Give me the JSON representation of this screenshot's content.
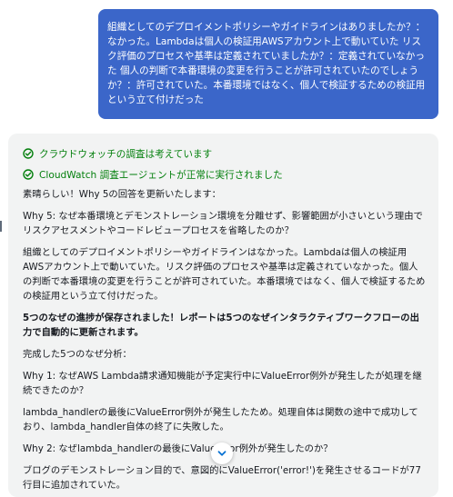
{
  "user_message": "組織としてのデプロイメントポリシーやガイドラインはありましたか？：なかった。Lambdaは個人の検証用AWSアカウント上で動いていた リスク評価のプロセスや基準は定義されていましたか？：定義されていなかった 個人の判断で本番環境の変更を行うことが許可されていたのでしょうか？：許可されていた。本番環境ではなく、個人で検証するための検証用という立て付けだった",
  "status_items": [
    {
      "label": "クラウドウォッチの調査は考えています",
      "color": "#037f0c",
      "icon": "check-circle-icon"
    },
    {
      "label": "CloudWatch 調査エージェントが正常に実行されました",
      "color": "#037f0c",
      "icon": "check-circle-icon"
    }
  ],
  "message": {
    "intro": "素晴らしい！Why 5の回答を更新いたします：",
    "why5": "Why 5: なぜ本番環境とデモンストレーション環境を分離せず、影響範囲が小さいという理由でリスクアセスメントやコードレビュープロセスを省略したのか？",
    "why5_answer": "組織としてのデプロイメントポリシーやガイドラインはなかった。Lambdaは個人の検証用AWSアカウント上で動いていた。リスク評価のプロセスや基準は定義されていなかった。個人の判断で本番環境の変更を行うことが許可されていた。本番環境ではなく、個人で検証するための検証用という立て付けだった。",
    "saved_notice": "5つのなぜの進捗が保存されました！レポートは5つのなぜインタラクティブワークフローの出力で自動的に更新されます。",
    "analysis_heading": "完成した5つのなぜ分析：",
    "why1": "Why 1: なぜAWS Lambda請求通知機能が予定実行中にValueError例外が発生したが処理を継続できたのか？",
    "why1_answer": "lambda_handlerの最後にValueError例外が発生したため。処理自体は関数の途中で成功しており、lambda_handler自体の終了に失敗した。",
    "why2": "Why 2: なぜlambda_handlerの最後にValueError例外が発生したのか？",
    "why2_answer": "ブログのデモンストレーション目的で、意図的にValueError('error!')を発生させるコードが77行目に追加されていた。"
  },
  "accent_colors": {
    "user_bubble": "#3b66c9",
    "success": "#037f0c",
    "panel": "#f2f3f3"
  },
  "scroll_icon": "chevron-down-icon"
}
